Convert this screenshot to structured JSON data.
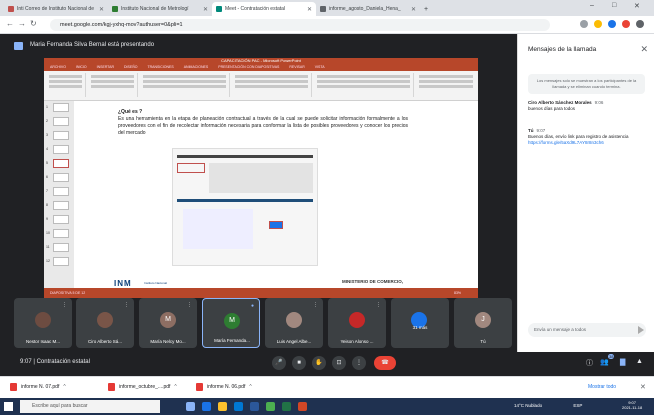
{
  "browser": {
    "tabs": [
      {
        "label": "Inti Correo de Instituto Nacional de",
        "color": "#c0504d",
        "active": false
      },
      {
        "label": "Instituto Nacional de Metrologí",
        "color": "#2e7d32",
        "active": false
      },
      {
        "label": "Meet - Contratación estatal",
        "color": "#00897b",
        "active": true
      },
      {
        "label": "informe_agosto_Daniela_Hena_",
        "color": "#5f6368",
        "active": false
      }
    ],
    "new_tab": "+",
    "url": "meet.google.com/kgj-yxhq-mov?authuser=0&pli=1",
    "window_controls": [
      "–",
      "□",
      "✕"
    ]
  },
  "meet_header": {
    "presenting_text": "Maria Fernanda Silva Bernal está presentando"
  },
  "presentation": {
    "window_title": "CAPACITACIÓN PAC - Microsoft PowerPoint",
    "ribbon_tabs": [
      "ARCHIVO",
      "INICIO",
      "INSERTAR",
      "DISEÑO",
      "TRANSICIONES",
      "ANIMACIONES",
      "PRESENTACIÓN CON DIAPOSITIVAS",
      "REVISAR",
      "VISTA"
    ],
    "slide_numbers": [
      "1",
      "2",
      "3",
      "4",
      "5",
      "6",
      "7",
      "8",
      "9",
      "10",
      "11",
      "12"
    ],
    "slide_heading": "¿Qué es ?",
    "slide_body": "Es una herramienta en la etapa de planeación contractual a través de la cual se puede solicitar información formalmente a los proveedores con el fin de recolectar información necesaria para conformar la lista de posibles proveedores y conocer los precios del mercado",
    "logo_left": "INM",
    "logo_left_sub": "Instituto Nacional",
    "logo_right": "MINISTERIO DE COMERCIO,",
    "status_left": "DIAPOSITIVA 5 DE 12",
    "status_right": "83%"
  },
  "chat_panel": {
    "title": "Mensajes de la llamada",
    "close": "✕",
    "notice": "Los mensajes solo se muestran a los participantes de la llamada y se eliminan cuando termina.",
    "messages": [
      {
        "sender": "Ciro Alberto Sánchez Morales",
        "time": "9:06",
        "text": "buenos días para todos",
        "link": ""
      },
      {
        "sender": "Tú",
        "time": "9:07",
        "text": "Buenos días, envío link para registro de asistencia",
        "link": "https://forms.gle/5aXd9L7AY8r8n3ch6"
      }
    ],
    "input_placeholder": "Envía un mensaje a todos"
  },
  "participants": [
    {
      "name": "Nestor Isaac M...",
      "initial": "",
      "color": "#6d4c41"
    },
    {
      "name": "Ciro Alberto Sá...",
      "initial": "",
      "color": "#795548"
    },
    {
      "name": "María Nelcy Mo...",
      "initial": "M",
      "color": "#8d6e63"
    },
    {
      "name": "María Fernanda...",
      "initial": "M",
      "color": "#2e7d32",
      "active": true
    },
    {
      "name": "Luis Angel Albe...",
      "initial": "",
      "color": "#a1887f"
    },
    {
      "name": "Yeison Alonso ...",
      "initial": "",
      "color": "#c62828"
    },
    {
      "name": "31 más",
      "initial": "",
      "color": "#1a73e8"
    },
    {
      "name": "Tú",
      "initial": "J",
      "color": "#a1887f"
    }
  ],
  "meet_bar": {
    "time_meeting": "9:07 | Contratación estatal",
    "participant_count": "38"
  },
  "downloads": {
    "items": [
      "informe N. 07.pdf",
      "informe_octubre_....pdf",
      "informe N. 06.pdf"
    ],
    "show_all": "Mostrar todo",
    "close": "✕"
  },
  "taskbar": {
    "search_placeholder": "Escribe aquí para buscar",
    "weather": "14°C Nublado",
    "lang": "ESP",
    "time": "9:07",
    "date": "2021-11-18"
  }
}
